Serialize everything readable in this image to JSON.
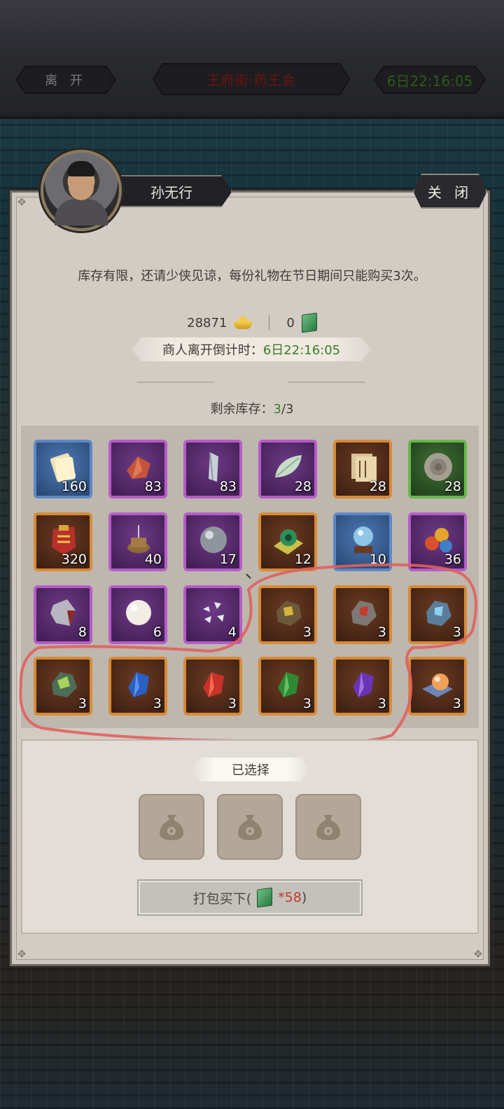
{
  "topbar": {
    "leave_label": "离 开",
    "title": "王府街·药王会",
    "timer": "6日22:16:05"
  },
  "merchant": {
    "name": "孙无行",
    "close_label": "关 闭"
  },
  "notice": "库存有限，还请少侠见谅，每份礼物在节日期间只能购买3次。",
  "currency": {
    "gold": "28871",
    "jade": "0"
  },
  "countdown": {
    "label": "商人离开倒计时：",
    "time": "6日22:16:05"
  },
  "stock": {
    "label": "剩余库存：",
    "current": "3",
    "total": "/3"
  },
  "items": [
    {
      "name": "scroll-bundle",
      "rarity": "blue",
      "qty": "160"
    },
    {
      "name": "red-crystal-shard",
      "rarity": "purple",
      "qty": "83"
    },
    {
      "name": "silver-crystal",
      "rarity": "purple",
      "qty": "83"
    },
    {
      "name": "jade-leaf",
      "rarity": "purple",
      "qty": "28"
    },
    {
      "name": "manual-books",
      "rarity": "orange",
      "qty": "28"
    },
    {
      "name": "stone-disc",
      "rarity": "green",
      "qty": "28"
    },
    {
      "name": "red-token",
      "rarity": "orange",
      "qty": "320"
    },
    {
      "name": "incense-burner",
      "rarity": "purple",
      "qty": "40"
    },
    {
      "name": "iron-ball",
      "rarity": "purple",
      "qty": "17"
    },
    {
      "name": "jade-scroll-orb",
      "rarity": "orange",
      "qty": "12"
    },
    {
      "name": "crystal-ball",
      "rarity": "blue",
      "qty": "10"
    },
    {
      "name": "colored-beads",
      "rarity": "purple",
      "qty": "36"
    },
    {
      "name": "dark-ore",
      "rarity": "purple",
      "qty": "8"
    },
    {
      "name": "pearl",
      "rarity": "purple",
      "qty": "6"
    },
    {
      "name": "silver-fragments",
      "rarity": "purple",
      "qty": "4"
    },
    {
      "name": "gold-ore",
      "rarity": "orange",
      "qty": "3"
    },
    {
      "name": "ruby-ore",
      "rarity": "orange",
      "qty": "3"
    },
    {
      "name": "sapphire-ore",
      "rarity": "orange",
      "qty": "3"
    },
    {
      "name": "green-ore",
      "rarity": "orange",
      "qty": "3"
    },
    {
      "name": "blue-gem",
      "rarity": "orange",
      "qty": "3"
    },
    {
      "name": "red-gem",
      "rarity": "orange",
      "qty": "3"
    },
    {
      "name": "emerald-gem",
      "rarity": "orange",
      "qty": "3"
    },
    {
      "name": "amethyst-gem",
      "rarity": "orange",
      "qty": "3"
    },
    {
      "name": "orange-pearl-scroll",
      "rarity": "orange",
      "qty": "3"
    }
  ],
  "selected": {
    "title": "已选择",
    "slots": [
      "empty",
      "empty",
      "empty"
    ]
  },
  "buy": {
    "label_prefix": "打包买下(",
    "price": "*58",
    "label_suffix": ")"
  },
  "colors": {
    "green_text": "#3d7a2a",
    "price_red": "#c0392b",
    "annotation_red": "#e0605f"
  }
}
